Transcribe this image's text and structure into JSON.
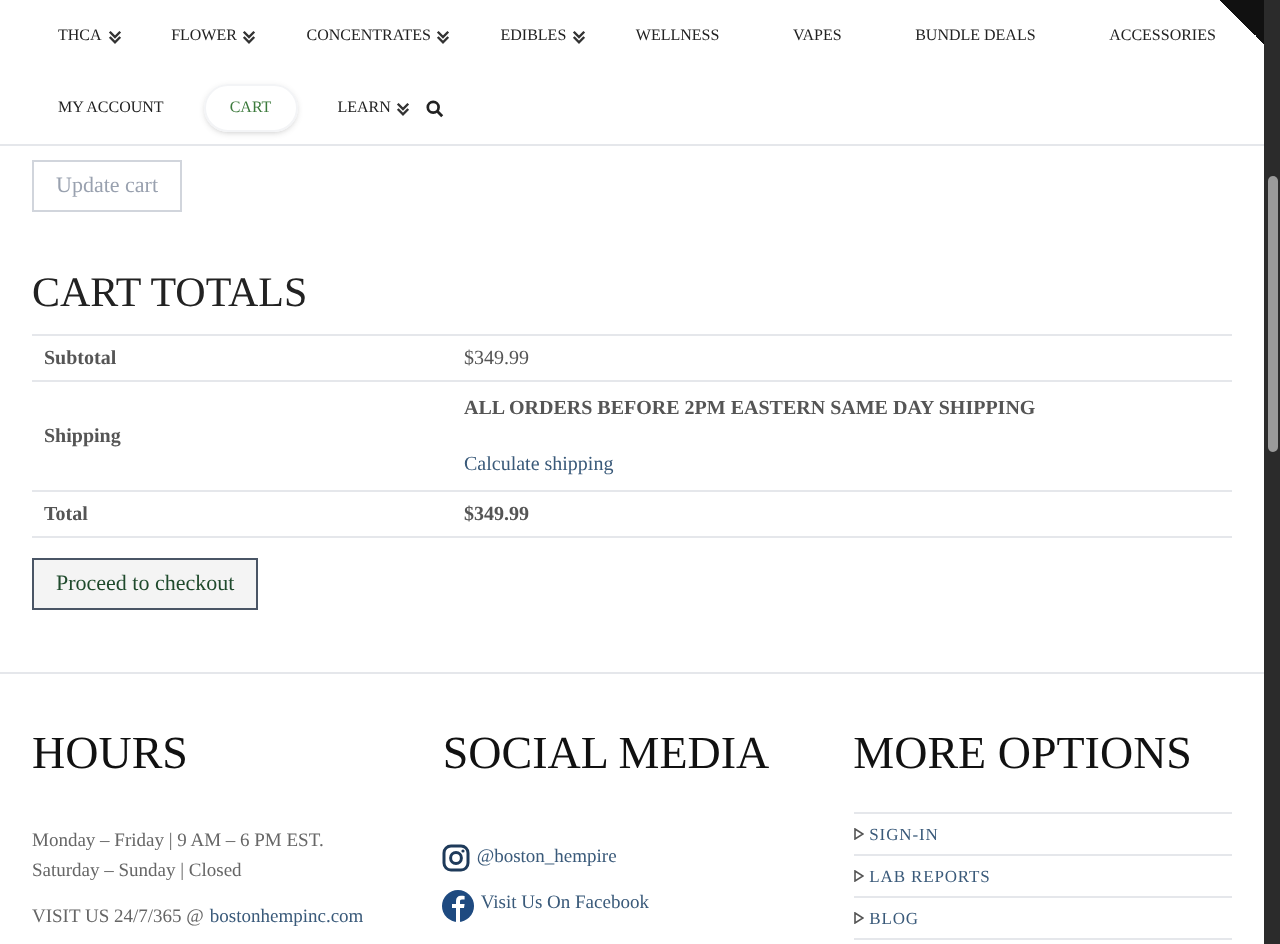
{
  "nav": [
    {
      "label": "THCA",
      "dropdown": true,
      "selected": false
    },
    {
      "label": "FLOWER",
      "dropdown": true,
      "selected": false
    },
    {
      "label": "CONCENTRATES",
      "dropdown": true,
      "selected": false
    },
    {
      "label": "EDIBLES",
      "dropdown": true,
      "selected": false
    },
    {
      "label": "WELLNESS",
      "dropdown": false,
      "selected": false
    },
    {
      "label": "VAPES",
      "dropdown": false,
      "selected": false
    },
    {
      "label": "BUNDLE DEALS",
      "dropdown": false,
      "selected": false
    },
    {
      "label": "ACCESSORIES",
      "dropdown": false,
      "selected": false
    },
    {
      "label": "MY ACCOUNT",
      "dropdown": false,
      "selected": false
    },
    {
      "label": "CART",
      "dropdown": false,
      "selected": true
    },
    {
      "label": "LEARN",
      "dropdown": true,
      "selected": false
    }
  ],
  "update_button": {
    "label": "Update cart",
    "disabled": true
  },
  "cart_totals": {
    "title": "CART TOTALS",
    "rows": [
      {
        "kind": "plain",
        "label": "Subtotal",
        "value": "$349.99"
      },
      {
        "kind": "shipping",
        "label": "Shipping",
        "value": "ALL ORDERS BEFORE 2PM EASTERN SAME DAY SHIPPING",
        "link": "Calculate shipping"
      },
      {
        "kind": "total",
        "label": "Total",
        "value": "$349.99"
      }
    ],
    "checkout_button": "Proceed to checkout"
  },
  "footer": {
    "hours": {
      "title": "HOURS",
      "lines": [
        "Monday – Friday | 9 AM – 6 PM EST.",
        "Saturday – Sunday | Closed"
      ],
      "visit_text": "VISIT US 24/7/365 @",
      "visit_link": "bostonhempinc.com"
    },
    "social": {
      "title": "SOCIAL MEDIA",
      "links": [
        {
          "kind": "instagram",
          "label": "@boston_hempire"
        },
        {
          "kind": "facebook",
          "label": "Visit Us On Facebook"
        }
      ]
    },
    "more": {
      "title": "MORE OPTIONS",
      "links": [
        "SIGN-IN",
        "LAB REPORTS",
        "BLOG"
      ]
    }
  }
}
